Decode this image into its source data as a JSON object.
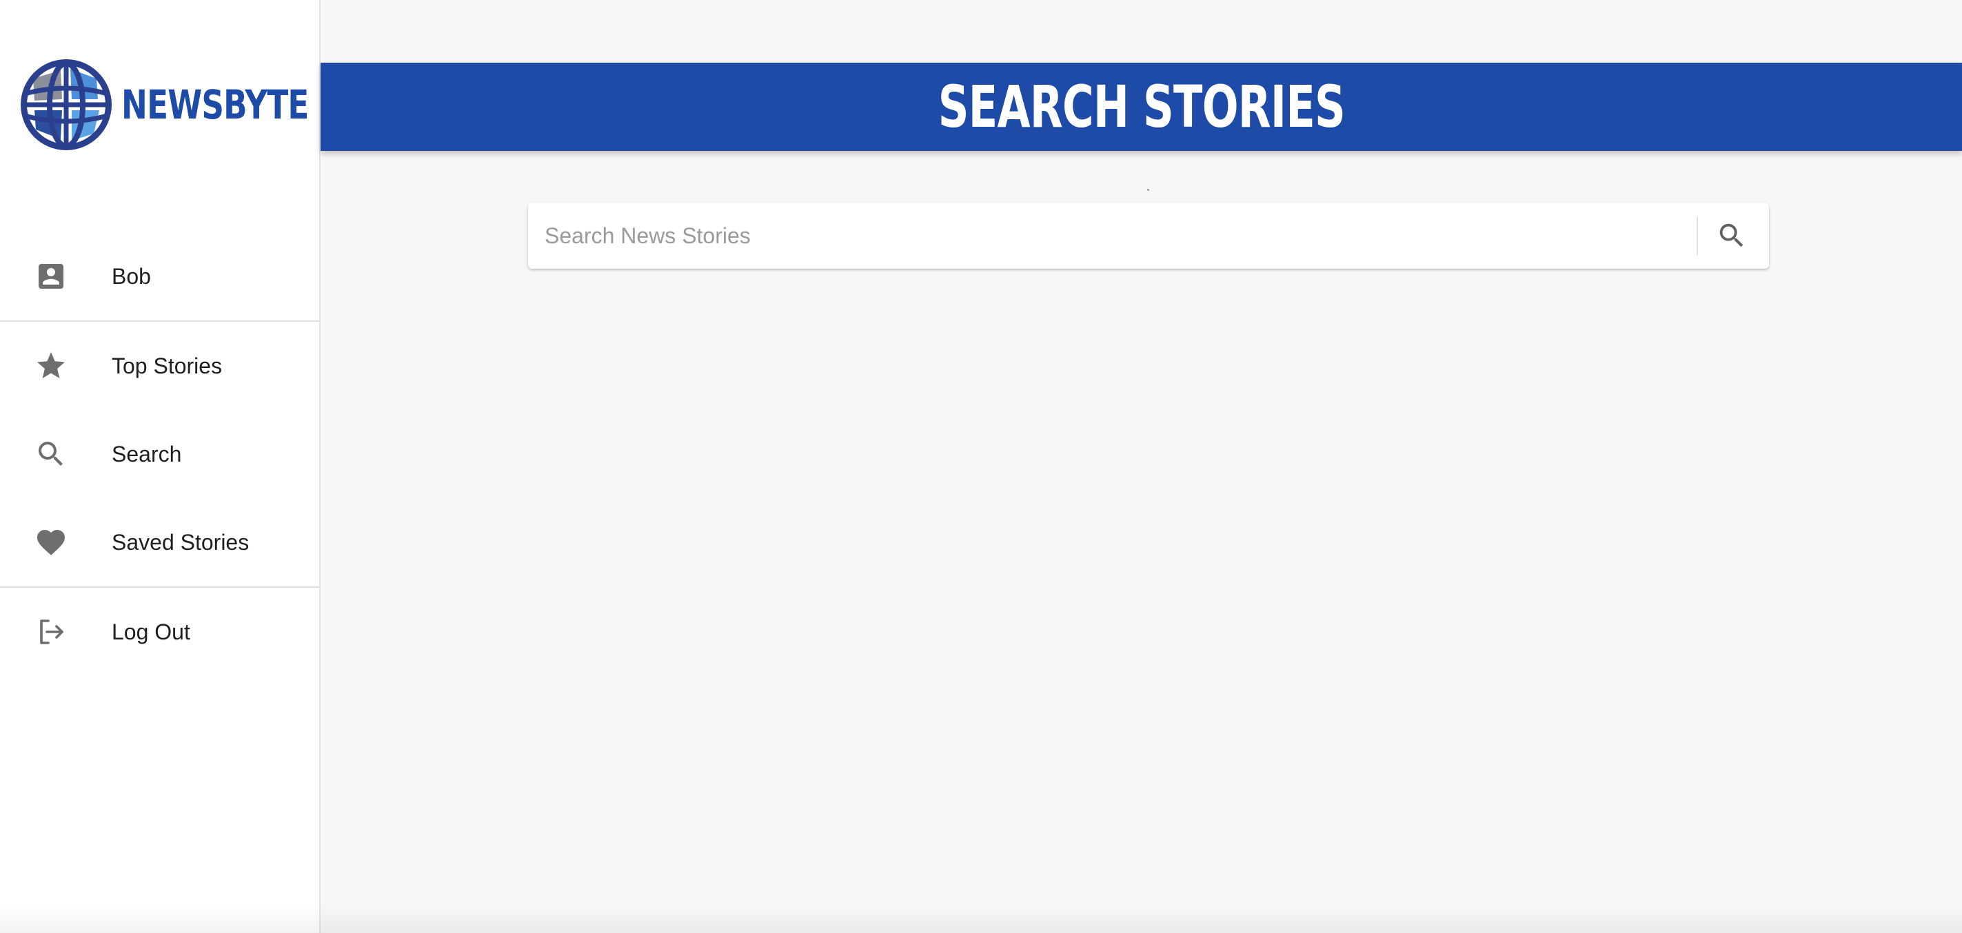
{
  "brand": {
    "name": "NEWSBYTE",
    "logo_icon": "globe-icon"
  },
  "sidebar": {
    "items": [
      {
        "label": "Bob",
        "icon": "account-box-icon"
      },
      {
        "label": "Top Stories",
        "icon": "star-icon"
      },
      {
        "label": "Search",
        "icon": "search-icon"
      },
      {
        "label": "Saved Stories",
        "icon": "heart-icon"
      },
      {
        "label": "Log Out",
        "icon": "logout-icon"
      }
    ]
  },
  "header": {
    "title": "SEARCH STORIES"
  },
  "search": {
    "placeholder": "Search News Stories",
    "value": "",
    "button_icon": "search-icon"
  },
  "colors": {
    "brand_blue": "#1f4ba8",
    "background": "#f8f7f5",
    "sidebar_bg": "#ffffff",
    "icon_gray": "#6e6e6e"
  }
}
